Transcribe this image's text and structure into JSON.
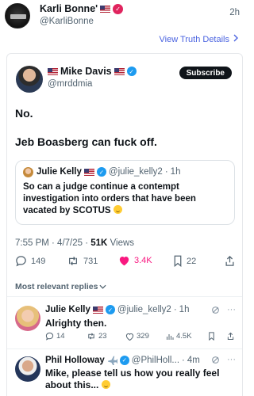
{
  "truth": {
    "author": "Karli Bonne'",
    "handle": "@KarliBonne",
    "time": "2h",
    "view_details": "View Truth Details",
    "view_details_chevron": ">"
  },
  "post": {
    "author": "Mike Davis",
    "handle": "@mrddmia",
    "subscribe_label": "Subscribe",
    "lines": [
      "No.",
      "Jeb Boasberg can fuck off."
    ],
    "quote": {
      "author": "Julie Kelly",
      "handle": "@julie_kelly2",
      "time": "1h",
      "separator": "·",
      "text": "So can a judge continue a contempt investigation into orders that have been vacated by SCOTUS"
    },
    "timestamp": "7:55 PM · 4/7/25 · ",
    "views_count": "51K",
    "views_label": "Views",
    "stats": {
      "replies": "149",
      "retweets": "731",
      "likes": "3.4K",
      "bookmarks": "22"
    }
  },
  "replies_sort": "Most relevant replies",
  "replies": [
    {
      "author": "Julie Kelly",
      "handle": "@julie_kelly2",
      "time": "1h",
      "separator": "·",
      "text": "Alrighty then.",
      "stats": {
        "replies": "14",
        "retweets": "23",
        "likes": "329",
        "views": "4.5K"
      }
    },
    {
      "author": "Phil Holloway",
      "handle": "@PhilHoll...",
      "time": "4m",
      "separator": "·",
      "text": "Mike, please tell us how you really feel about this..."
    }
  ],
  "more_glyph": "···",
  "colors": {
    "accent": "#1d9bf0",
    "like": "#f91880",
    "truth_link": "#4a63e0",
    "badge_red": "#e0245e"
  },
  "icons": [
    "flag-usa-icon",
    "verified-badge-icon",
    "reply-icon",
    "retweet-icon",
    "heart-icon",
    "bookmark-icon",
    "share-icon",
    "views-icon",
    "grok-icon",
    "plane-icon",
    "chevron-down-icon",
    "chevron-right-icon"
  ]
}
